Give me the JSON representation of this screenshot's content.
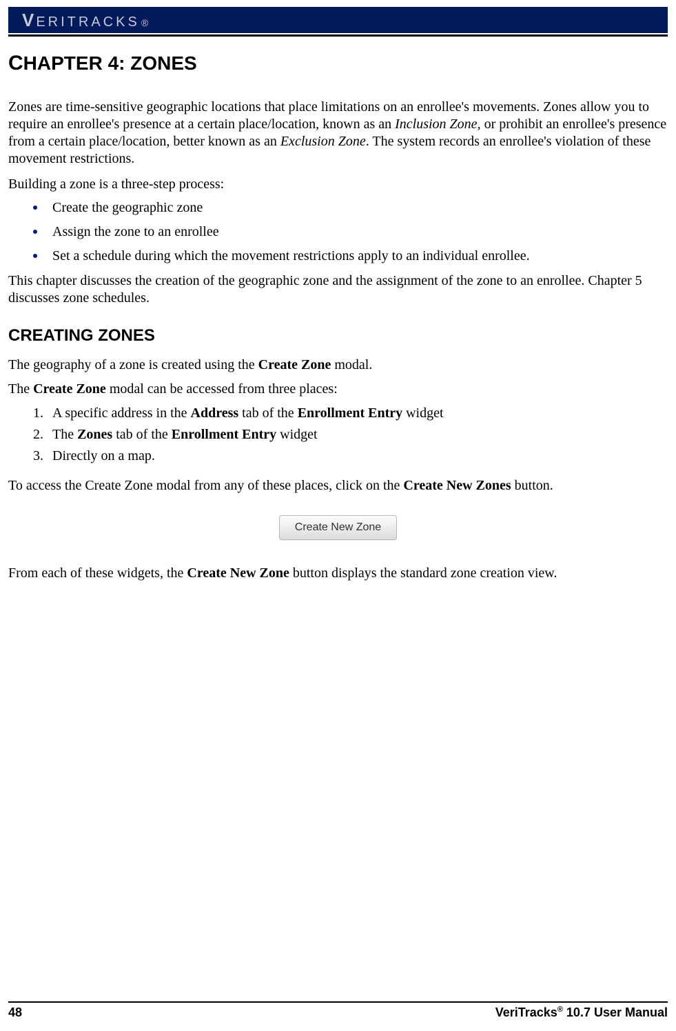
{
  "header": {
    "brand_v": "V",
    "brand_rest": "ERITRACKS",
    "brand_mark": "®"
  },
  "chapter": {
    "title_prefix": "C",
    "title_text": "HAPTER 4:   Z",
    "title_suffix": "ONES"
  },
  "body": {
    "p1_a": "Zones are time-sensitive geographic locations that place limitations on an enrollee's movements. Zones allow you to require an enrollee's presence at a certain place/location, known as an ",
    "p1_em1": "Inclusion Zone",
    "p1_b": ", or prohibit an enrollee's presence from a certain place/location, better known as an ",
    "p1_em2": "Exclusion Zone",
    "p1_c": ". The system records an enrollee's violation of these movement restrictions.",
    "p2": "Building a zone is a three-step process:",
    "bullets": [
      "Create the geographic zone",
      "Assign the zone to an enrollee",
      "Set a schedule during which the movement restrictions apply to an individual enrollee."
    ],
    "p3": "This chapter discusses the creation of the geographic zone and the assignment of the zone to an enrollee. Chapter 5 discusses zone schedules.",
    "h2_a": "C",
    "h2_b": "REATING Z",
    "h2_c": "ONES",
    "p4_a": "The geography of a zone is created using the ",
    "p4_b": "Create Zone",
    "p4_c": " modal.",
    "p5_a": "The ",
    "p5_b": "Create Zone",
    "p5_c": " modal can be accessed from three places:",
    "num1_a": "A specific address in the ",
    "num1_b": "Address",
    "num1_c": " tab of the ",
    "num1_d": "Enrollment Entry",
    "num1_e": " widget",
    "num2_a": "The ",
    "num2_b": "Zones",
    "num2_c": " tab of the ",
    "num2_d": "Enrollment Entry",
    "num2_e": " widget",
    "num3": "Directly on a map.",
    "p6_a": "To access the Create Zone modal from any of these places, click on the ",
    "p6_b": "Create New Zones",
    "p6_c": " button.",
    "button_label": "Create New Zone",
    "p7_a": "From each of these widgets, the ",
    "p7_b": "Create New Zone",
    "p7_c": " button displays the standard zone creation view."
  },
  "footer": {
    "page_num": "48",
    "right_a": "VeriTracks",
    "right_sup": "®",
    "right_b": " 10.7 User Manual"
  }
}
